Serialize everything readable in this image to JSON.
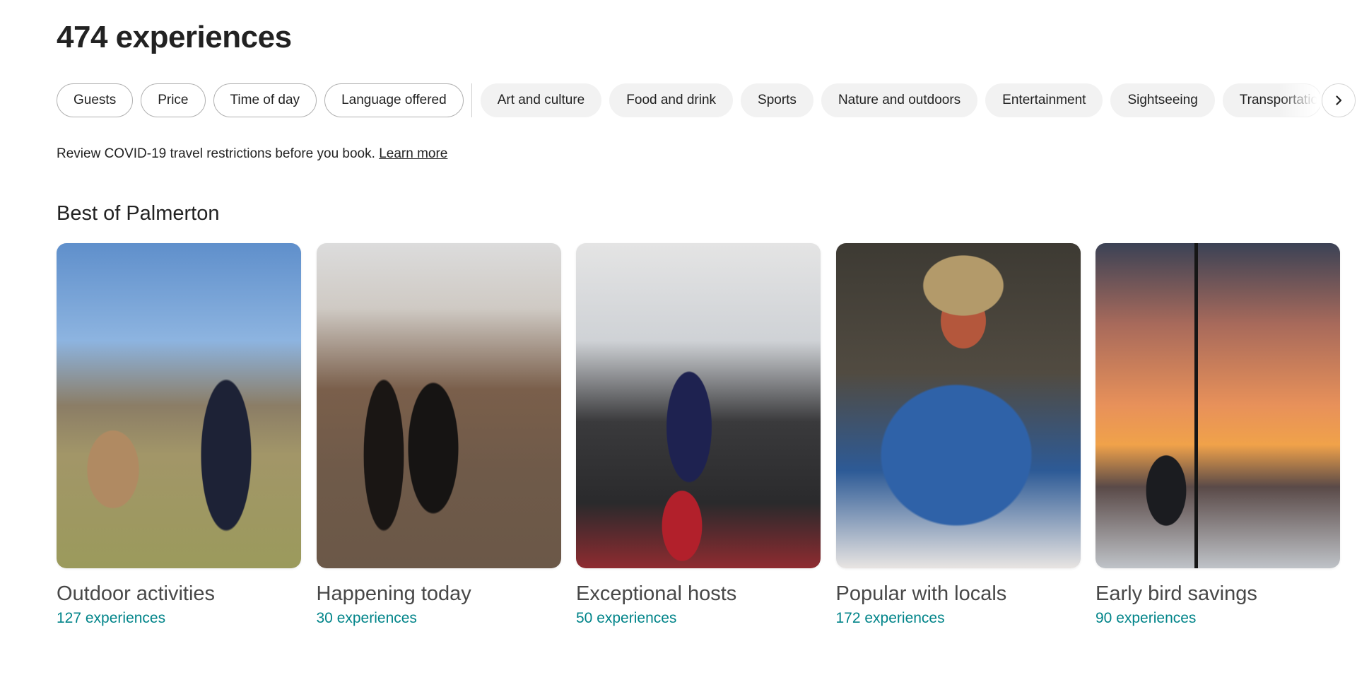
{
  "header": {
    "title": "474 experiences"
  },
  "filters": {
    "outlined": [
      {
        "label": "Guests"
      },
      {
        "label": "Price"
      },
      {
        "label": "Time of day"
      },
      {
        "label": "Language offered"
      }
    ],
    "categories": [
      {
        "label": "Art and culture"
      },
      {
        "label": "Food and drink"
      },
      {
        "label": "Sports"
      },
      {
        "label": "Nature and outdoors"
      },
      {
        "label": "Entertainment"
      },
      {
        "label": "Sightseeing"
      },
      {
        "label": "Transportation"
      }
    ],
    "next_icon": "chevron-right-icon"
  },
  "notice": {
    "text": "Review COVID-19 travel restrictions before you book.",
    "link": "Learn more"
  },
  "section": {
    "title": "Best of Palmerton",
    "accent_color": "#008489",
    "cards": [
      {
        "title": "Outdoor activities",
        "count": "127 experiences",
        "image": "People feeding an alpaca in a field"
      },
      {
        "title": "Happening today",
        "count": "30 experiences",
        "image": "Couple kissing on a bridge"
      },
      {
        "title": "Exceptional hosts",
        "count": "50 experiences",
        "image": "Boxer training in a gym"
      },
      {
        "title": "Popular with locals",
        "count": "172 experiences",
        "image": "Man with straw hat and red glasses"
      },
      {
        "title": "Early bird savings",
        "count": "90 experiences",
        "image": "Sailboat at sunset"
      }
    ]
  }
}
